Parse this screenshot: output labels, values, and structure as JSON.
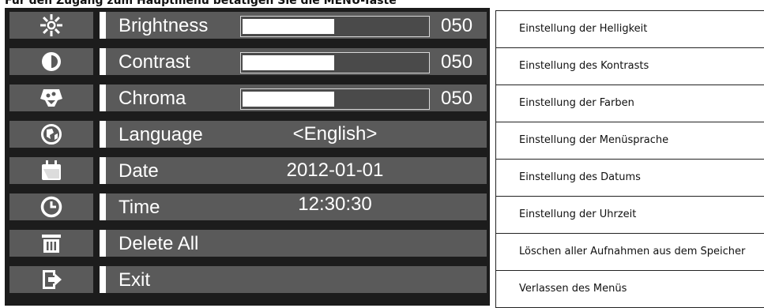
{
  "caption": "Für den Zugang zum Hauptmenü betätigen Sie die MENU-Taste",
  "menu": {
    "brightness": {
      "label": "Brightness",
      "value": "050",
      "level": 0.5
    },
    "contrast": {
      "label": "Contrast",
      "value": "050",
      "level": 0.5
    },
    "chroma": {
      "label": "Chroma",
      "value": "050",
      "level": 0.5
    },
    "language": {
      "label": "Language",
      "value": "<English>"
    },
    "date": {
      "label": "Date",
      "value": "2012-01-01"
    },
    "time": {
      "label": "Time",
      "value": "12:30:30"
    },
    "delete_all": {
      "label": "Delete All"
    },
    "exit": {
      "label": "Exit"
    }
  },
  "descriptions": [
    "Einstellung der Helligkeit",
    "Einstellung des Kontrasts",
    "Einstellung der Farben",
    "Einstellung der Menüsprache",
    "Einstellung des Datums",
    "Einstellung der Uhrzeit",
    "Löschen aller Aufnahmen aus dem Speicher",
    "Verlassen des Menüs"
  ],
  "icons": [
    "sun-icon",
    "contrast-icon",
    "chroma-icon",
    "globe-icon",
    "calendar-icon",
    "clock-icon",
    "trash-icon",
    "exit-icon"
  ],
  "colors": {
    "panel": "#1c1c1c",
    "cell": "#5a5a5a",
    "text": "#ffffff"
  }
}
